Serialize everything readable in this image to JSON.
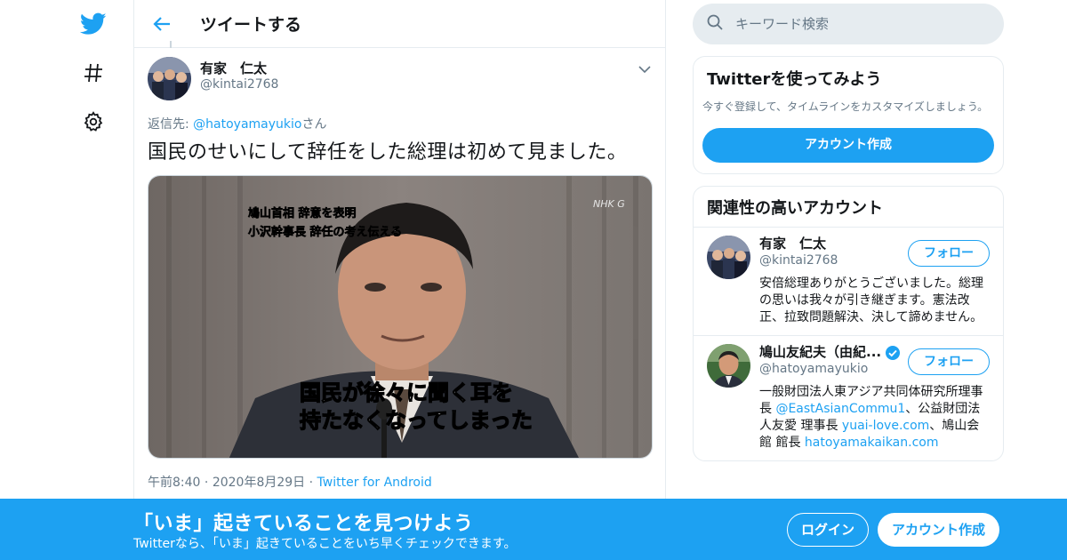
{
  "header": {
    "title": "ツイートする"
  },
  "tweet": {
    "author_name": "有家　仁太",
    "author_handle": "@kintai2768",
    "reply_prefix": "返信先: ",
    "reply_handle": "@hatoyamayukio",
    "reply_suffix": "さん",
    "text": "国民のせいにして辞任をした総理は初めて見ました。",
    "media": {
      "caption_top_1": "鳩山首相 辞意を表明",
      "caption_top_2": "小沢幹事長 辞任の考え伝える",
      "caption_bottom_1": "国民が徐々に聞く耳を",
      "caption_bottom_2": "持たなくなってしまった",
      "logo": "NHK G"
    },
    "time": "午前8:40",
    "date": "2020年8月29日",
    "separator": "·",
    "source": "Twitter for Android"
  },
  "search": {
    "placeholder": "キーワード検索"
  },
  "signup_card": {
    "title": "Twitterを使ってみよう",
    "description": "今すぐ登録して、タイムラインをカスタマイズしましょう。",
    "button": "アカウント作成"
  },
  "related": {
    "title": "関連性の高いアカウント",
    "accounts": [
      {
        "name": "有家　仁太",
        "handle": "@kintai2768",
        "verified": false,
        "follow": "フォロー",
        "bio": "安倍総理ありがとうございました。総理の思いは我々が引き継ぎます。憲法改正、拉致問題解決、決して諦めません。"
      },
      {
        "name": "鳩山友紀夫（由紀...",
        "handle": "@hatoyamayukio",
        "verified": true,
        "follow": "フォロー",
        "bio_1": "一般財団法人東アジア共同体研究所理事長 ",
        "bio_link_1": "@EastAsianCommu1",
        "bio_2": "、公益財団法人友愛 理事長 ",
        "bio_link_2": "yuai-love.com",
        "bio_3": "、鳩山会館 館長 ",
        "bio_link_3": "hatoyamakaikan.com"
      }
    ]
  },
  "bottom_bar": {
    "title": "「いま」起きていることを見つけよう",
    "subtitle": "Twitterなら、「いま」起きていることをいち早くチェックできます。",
    "login": "ログイン",
    "signup": "アカウント作成"
  },
  "colors": {
    "accent": "#1da1f2",
    "muted": "#657786",
    "border": "#e6ecf0"
  },
  "icons": [
    "twitter-bird-icon",
    "hashtag-icon",
    "gear-icon",
    "back-arrow-icon",
    "chevron-down-icon",
    "search-icon",
    "verified-badge-icon"
  ]
}
